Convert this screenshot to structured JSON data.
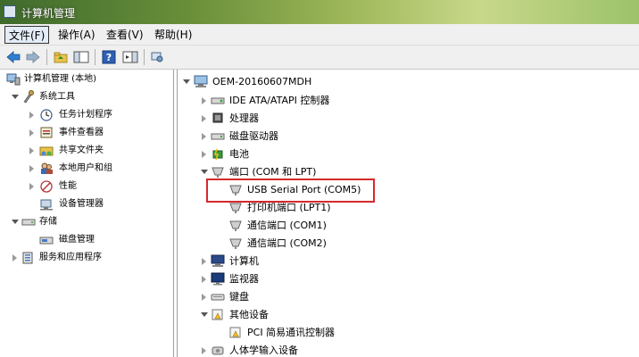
{
  "window": {
    "title": "计算机管理"
  },
  "menu": [
    {
      "label": "文件(F)"
    },
    {
      "label": "操作(A)"
    },
    {
      "label": "查看(V)"
    },
    {
      "label": "帮助(H)"
    }
  ],
  "toolbar": {
    "buttons": [
      "back-arrow-icon",
      "forward-arrow-icon",
      "up-folder-icon",
      "show-hide-tree-icon",
      "help-icon",
      "action-pane-icon",
      "properties-icon"
    ]
  },
  "left_tree": [
    {
      "label": "计算机管理 (本地)",
      "icon": "computer-management-icon",
      "expand": "none"
    },
    {
      "label": "系统工具",
      "icon": "system-tools-icon",
      "expand": "open"
    },
    {
      "label": "任务计划程序",
      "icon": "task-scheduler-icon",
      "expand": "closed"
    },
    {
      "label": "事件查看器",
      "icon": "event-viewer-icon",
      "expand": "closed"
    },
    {
      "label": "共享文件夹",
      "icon": "shared-folders-icon",
      "expand": "closed"
    },
    {
      "label": "本地用户和组",
      "icon": "local-users-icon",
      "expand": "closed"
    },
    {
      "label": "性能",
      "icon": "performance-icon",
      "expand": "closed"
    },
    {
      "label": "设备管理器",
      "icon": "device-manager-icon",
      "expand": "none",
      "selected": true
    },
    {
      "label": "存储",
      "icon": "storage-icon",
      "expand": "open"
    },
    {
      "label": "磁盘管理",
      "icon": "disk-management-icon",
      "expand": "none"
    },
    {
      "label": "服务和应用程序",
      "icon": "services-apps-icon",
      "expand": "closed"
    }
  ],
  "right_tree": [
    {
      "label": "OEM-20160607MDH",
      "icon": "computer-icon",
      "expand": "open"
    },
    {
      "label": "IDE ATA/ATAPI 控制器",
      "icon": "ide-controller-icon",
      "expand": "closed"
    },
    {
      "label": "处理器",
      "icon": "processor-icon",
      "expand": "closed"
    },
    {
      "label": "磁盘驱动器",
      "icon": "disk-drive-icon",
      "expand": "closed"
    },
    {
      "label": "电池",
      "icon": "battery-icon",
      "expand": "closed"
    },
    {
      "label": "端口 (COM 和 LPT)",
      "icon": "port-icon",
      "expand": "open"
    },
    {
      "label": "USB Serial Port (COM5)",
      "icon": "port-icon",
      "expand": "none"
    },
    {
      "label": "打印机端口 (LPT1)",
      "icon": "port-icon",
      "expand": "none"
    },
    {
      "label": "通信端口 (COM1)",
      "icon": "port-icon",
      "expand": "none"
    },
    {
      "label": "通信端口 (COM2)",
      "icon": "port-icon",
      "expand": "none"
    },
    {
      "label": "计算机",
      "icon": "computer-icon",
      "expand": "closed"
    },
    {
      "label": "监视器",
      "icon": "monitor-icon",
      "expand": "closed"
    },
    {
      "label": "键盘",
      "icon": "keyboard-icon",
      "expand": "closed"
    },
    {
      "label": "其他设备",
      "icon": "unknown-device-icon",
      "expand": "open"
    },
    {
      "label": "PCI 简易通讯控制器",
      "icon": "unknown-device-icon",
      "expand": "none"
    },
    {
      "label": "人体学输入设备",
      "icon": "hid-icon",
      "expand": "closed"
    }
  ],
  "colors": {
    "highlight": "#d6292c",
    "titlebar_accent": "#6a8f3a"
  }
}
